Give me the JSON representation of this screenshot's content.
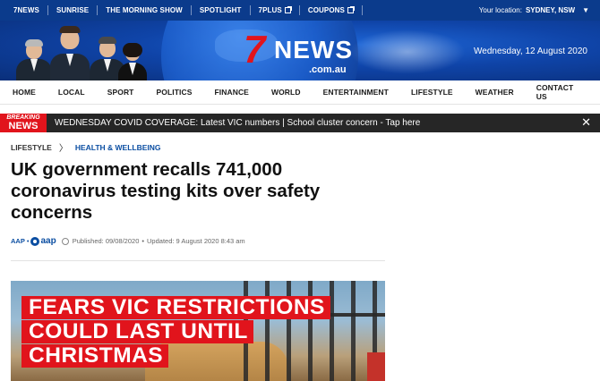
{
  "topbar": {
    "links": [
      "7NEWS",
      "SUNRISE",
      "THE MORNING SHOW",
      "SPOTLIGHT",
      "7PLUS",
      "COUPONS"
    ],
    "location_label": "Your location:",
    "location_value": "SYDNEY, NSW"
  },
  "banner": {
    "logo_number": "7",
    "logo_word": "NEWS",
    "logo_domain": ".com.au",
    "date": "Wednesday, 12 August 2020"
  },
  "nav": {
    "items": [
      "HOME",
      "LOCAL",
      "SPORT",
      "POLITICS",
      "FINANCE",
      "WORLD",
      "ENTERTAINMENT",
      "LIFESTYLE",
      "WEATHER",
      "CONTACT US"
    ]
  },
  "breaking": {
    "tag_top": "BREAKING",
    "tag_bottom": "NEWS",
    "message": "WEDNESDAY COVID COVERAGE: Latest VIC numbers | School cluster concern - Tap here",
    "close_symbol": "✕"
  },
  "article": {
    "breadcrumb_parent": "LIFESTYLE",
    "breadcrumb_child": "HEALTH & WELLBEING",
    "headline": "UK government recalls 741,000 coronavirus testing kits over safety concerns",
    "author": "AAP",
    "source_logo_text": "aap",
    "published": "Published: 09/08/2020",
    "updated": "Updated: 9 August 2020 8:43 am"
  },
  "hero": {
    "line1": "FEARS VIC RESTRICTIONS",
    "line2": "COULD LAST UNTIL",
    "line3": "CHRISTMAS"
  },
  "colors": {
    "topbar_bg": "#0b3b8c",
    "brand_red": "#e1141c",
    "link_blue": "#0b4ea2",
    "breaking_bg": "#262626"
  }
}
